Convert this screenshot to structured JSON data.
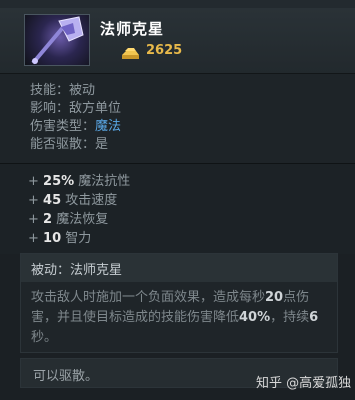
{
  "item": {
    "title": "法师克星",
    "gold": "2625"
  },
  "info": [
    {
      "label": "技能：",
      "value": "被动"
    },
    {
      "label": "影响：",
      "value": "敌方单位"
    },
    {
      "label": "伤害类型：",
      "value": "魔法"
    },
    {
      "label": "能否驱散：",
      "value": "是"
    }
  ],
  "stats": [
    {
      "prefix": "+ ",
      "num": "25%",
      "text": " 魔法抗性"
    },
    {
      "prefix": "+ ",
      "num": "45",
      "text": " 攻击速度"
    },
    {
      "prefix": "+ ",
      "num": "2",
      "text": " 魔法恢复"
    },
    {
      "prefix": "+ ",
      "num": "10",
      "text": " 智力"
    }
  ],
  "passive": {
    "title": "被动：法师克星",
    "desc_1": "攻击敌人时施加一个负面效果，造成每秒",
    "desc_dps": "20",
    "desc_2": "点伤害，并且使目标造成的技能伤害降低",
    "desc_pct": "40%",
    "desc_3": "，持续",
    "desc_dur": "6",
    "desc_4": "秒。"
  },
  "dispel": "可以驱散。",
  "watermark": "知乎 @高爱孤独",
  "colors": {
    "magic_damage": "#5aa8e6",
    "gold": "#e8b94a"
  },
  "icons": {
    "item": "mage-slayer-axe-icon",
    "gold": "gold-bar-icon"
  }
}
